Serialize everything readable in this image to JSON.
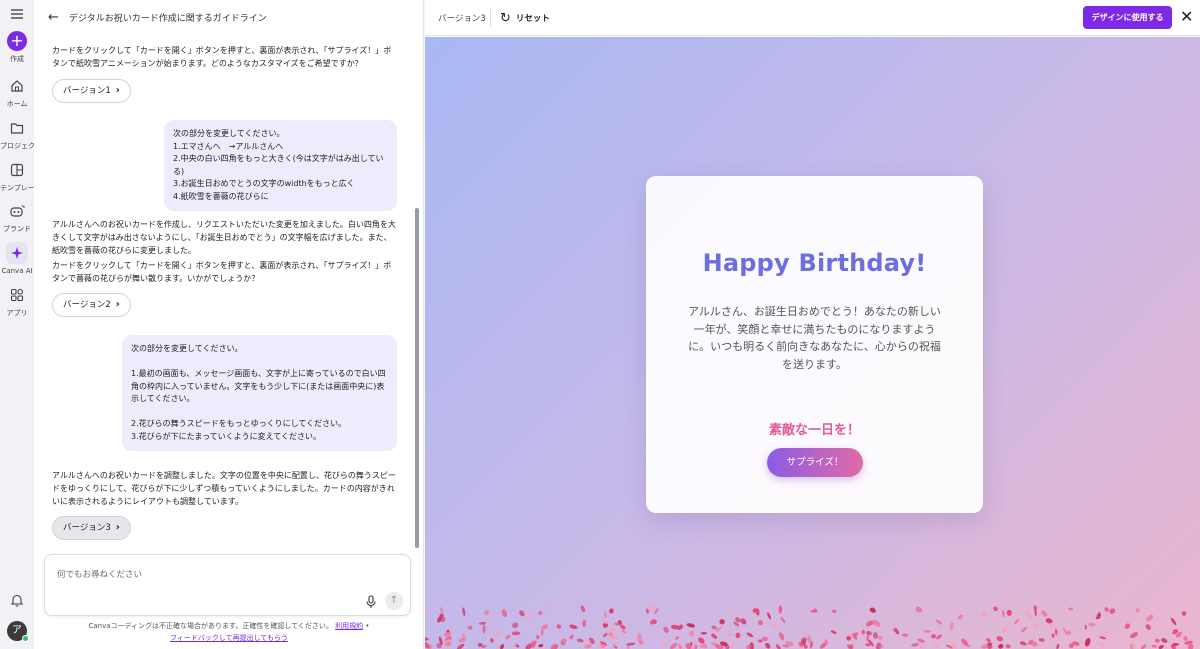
{
  "rail": {
    "items": [
      {
        "label": "作成",
        "icon": "plus-icon"
      },
      {
        "label": "ホーム",
        "icon": "home-icon"
      },
      {
        "label": "プロジェクト",
        "icon": "folder-icon"
      },
      {
        "label": "テンプレート",
        "icon": "template-icon"
      },
      {
        "label": "ブランド",
        "icon": "brand-icon"
      },
      {
        "label": "Canva AI",
        "icon": "sparkle-icon"
      },
      {
        "label": "アプリ",
        "icon": "apps-icon"
      }
    ],
    "avatar_initial": "ア"
  },
  "chat": {
    "title": "デジタルお祝いカード作成に関するガイドライン",
    "ai_msg_1": "カードをクリックして「カードを開く」ボタンを押すと、裏面が表示され、「サプライズ！」ボタンで紙吹雪アニメーションが始まります。どのようなカスタマイズをご希望ですか？",
    "version_1": "バージョン1",
    "user_msg_1": "次の部分を変更してください。\n1.エマさんへ　→アルルさんへ\n2.中央の白い四角をもっと大きく(今は文字がはみ出している)\n3.お誕生日おめでとうの文字のwidthをもっと広く\n4.紙吹雪を薔薇の花びらに",
    "ai_msg_2a": "アルルさんへのお祝いカードを作成し、リクエストいただいた変更を加えました。白い四角を大きくして文字がはみ出さないようにし、「お誕生日おめでとう」の文字幅を広げました。また、紙吹雪を薔薇の花びらに変更しました。",
    "ai_msg_2b": "カードをクリックして「カードを開く」ボタンを押すと、裏面が表示され、「サプライズ！」ボタンで薔薇の花びらが舞い散ります。いかがでしょうか？",
    "version_2": "バージョン2",
    "user_msg_2": "次の部分を変更してください。\n\n1.最初の画面も、メッセージ画面も、文字が上に寄っているので白い四角の枠内に入っていません。文字をもう少し下に(または画面中央に)表示してください。\n\n2.花びらの舞うスピードをもっとゆっくりにしてください。\n3.花びらが下にたまっていくように変えてください。",
    "ai_msg_3": "アルルさんへのお祝いカードを調整しました。文字の位置を中央に配置し、花びらの舞うスピードをゆっくりにして、花びらが下に少しずつ積もっていくようにしました。カードの内容がきれいに表示されるようにレイアウトも調整しています。",
    "version_3": "バージョン3",
    "input_placeholder": "何でもお尋ねください",
    "footer_text": "Canvaコーディングは不正確な場合があります。正確性を確認してください。",
    "footer_terms": "利用規約",
    "footer_feedback": "フィードバックして再提出してもらう"
  },
  "preview": {
    "version_label": "バージョン3",
    "reset_label": "リセット",
    "use_design_label": "デザインに使用する",
    "accent_color": "#7d2ae8"
  },
  "card": {
    "title": "Happy Birthday!",
    "message": "アルルさん、お誕生日おめでとう！あなたの新しい一年が、笑顔と幸せに満ちたものになりますように。いつも明るく前向きなあなたに、心からの祝福を送ります。",
    "subtitle": "素敵な一日を！",
    "button_label": "サプライズ！",
    "title_color": "#6c6fe0",
    "subtitle_color": "#e05a9b"
  }
}
